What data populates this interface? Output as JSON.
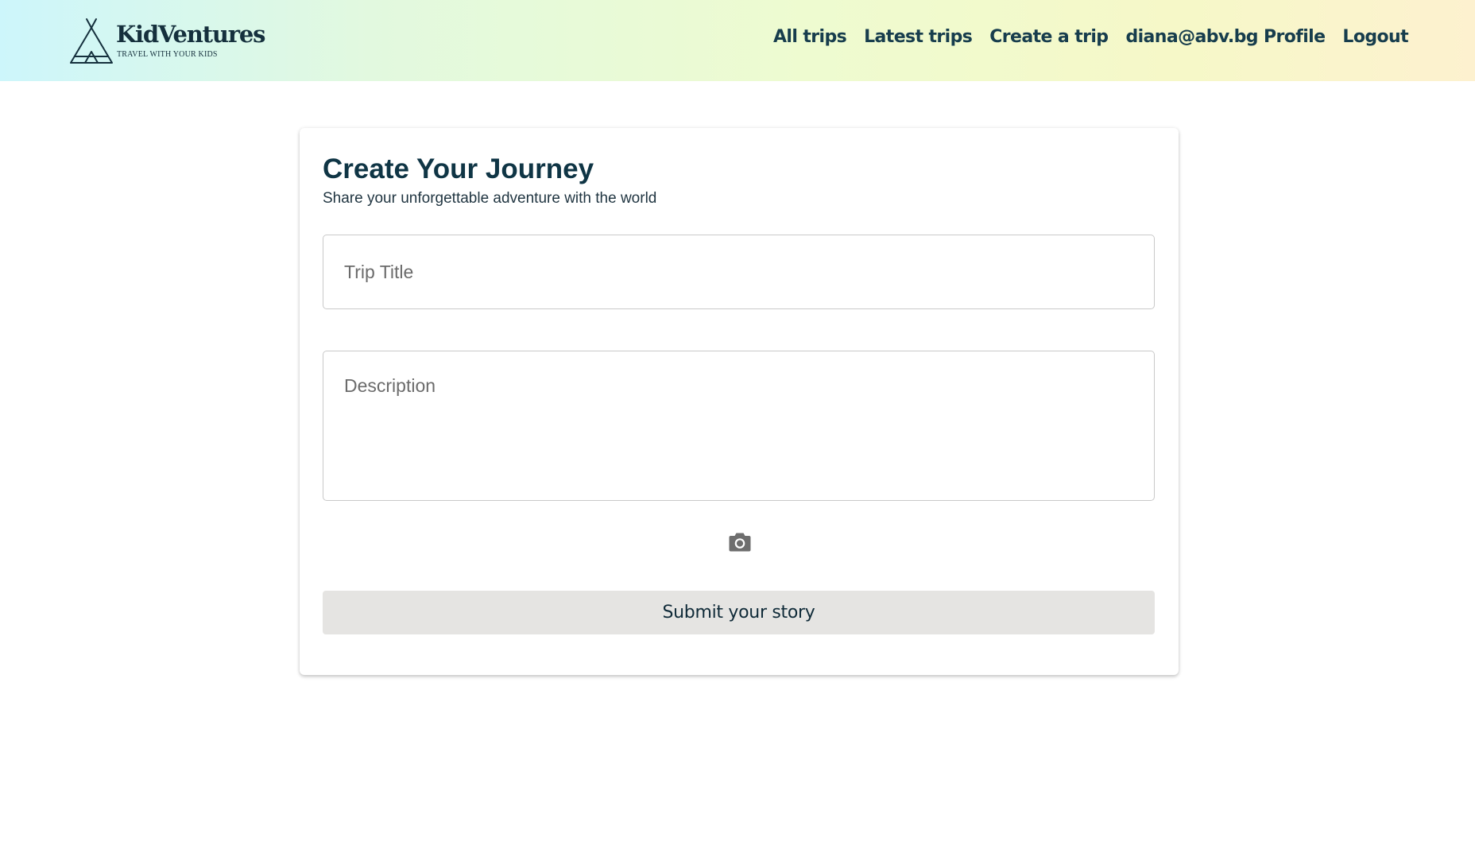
{
  "header": {
    "logo": {
      "name": "KidVentures",
      "tagline": "TRAVEL WITH YOUR KIDS",
      "icon": "teepee-tent-icon"
    },
    "nav": [
      {
        "label": "All trips"
      },
      {
        "label": "Latest trips"
      },
      {
        "label": "Create a trip"
      },
      {
        "label": "diana@abv.bg Profile"
      },
      {
        "label": "Logout"
      }
    ],
    "gradient_colors": [
      "#cdf6fb",
      "#e2f9df",
      "#eefbd0",
      "#f6f8c8",
      "#fdf1cf"
    ]
  },
  "form": {
    "title": "Create Your Journey",
    "subtitle": "Share your unforgettable adventure with the world",
    "trip_title": {
      "value": "",
      "placeholder": "Trip Title"
    },
    "description": {
      "value": "",
      "placeholder": "Description"
    },
    "image_upload": {
      "icon": "camera-icon"
    },
    "submit_label": "Submit your story"
  },
  "colors": {
    "brand_dark": "#173d4d",
    "button_bg": "#e5e4e2",
    "icon_gray": "#6e6e6e"
  }
}
